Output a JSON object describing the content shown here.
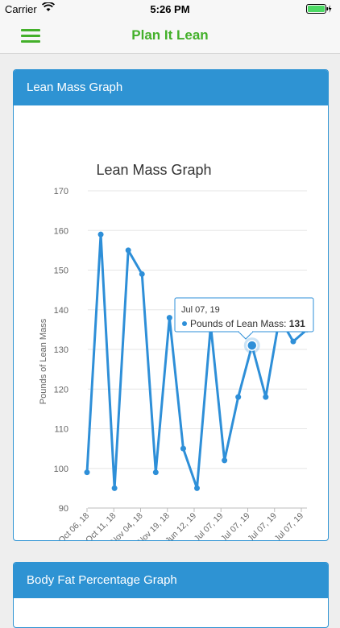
{
  "status": {
    "carrier": "Carrier",
    "time": "5:26 PM"
  },
  "nav": {
    "title": "Plan It Lean"
  },
  "cards": {
    "lean_mass": {
      "header": "Lean Mass Graph"
    },
    "body_fat": {
      "header": "Body Fat Percentage Graph"
    }
  },
  "tooltip": {
    "date": "Jul 07, 19",
    "label": "Pounds of Lean Mass:",
    "value": "131"
  },
  "colors": {
    "accent": "#43b02a",
    "card_header": "#2e93d3",
    "line": "#2e8fd8"
  },
  "chart_data": {
    "type": "line",
    "title": "Lean Mass Graph",
    "ylabel": "Pounds of Lean Mass",
    "ylim": [
      90,
      170
    ],
    "yticks": [
      90,
      100,
      110,
      120,
      130,
      140,
      150,
      160,
      170
    ],
    "grid": true,
    "tick_labels": [
      "Oct 06, 18",
      "Oct 11, 18",
      "Nov 04, 18",
      "Nov 19, 18",
      "Jun 12, 19",
      "Jul 07, 19",
      "Jul 07, 19",
      "Jul 07, 19",
      "Jul 07, 19"
    ],
    "series": [
      {
        "values": [
          99,
          159,
          95,
          155,
          149,
          99,
          138,
          105,
          95,
          136,
          102,
          118,
          131,
          118,
          138,
          132,
          135
        ]
      }
    ],
    "highlight_index": 12
  }
}
